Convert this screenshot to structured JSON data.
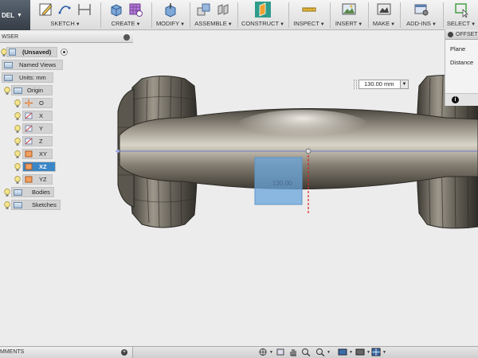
{
  "toolbar": {
    "workspace_label": "DEL",
    "groups": [
      {
        "label": "SKETCH"
      },
      {
        "label": "CREATE"
      },
      {
        "label": "MODIFY"
      },
      {
        "label": "ASSEMBLE"
      },
      {
        "label": "CONSTRUCT"
      },
      {
        "label": "INSPECT"
      },
      {
        "label": "INSERT"
      },
      {
        "label": "MAKE"
      },
      {
        "label": "ADD-INS"
      },
      {
        "label": "SELECT"
      }
    ]
  },
  "browser": {
    "title": "WSER",
    "items": [
      {
        "label": "(Unsaved)"
      },
      {
        "label": "Named Views"
      },
      {
        "label": "Units: mm"
      },
      {
        "label": "Origin"
      },
      {
        "label": "O"
      },
      {
        "label": "X"
      },
      {
        "label": "Y"
      },
      {
        "label": "Z"
      },
      {
        "label": "XY"
      },
      {
        "label": "XZ"
      },
      {
        "label": "YZ"
      },
      {
        "label": "Bodies"
      },
      {
        "label": "Sketches"
      }
    ]
  },
  "offset_panel": {
    "title": "OFFSET",
    "rows": [
      {
        "label": "Plane"
      },
      {
        "label": "Distance"
      }
    ],
    "info_icon": "i"
  },
  "dimension": {
    "value": "130.00 mm",
    "plane_label": "130.00"
  },
  "comments": {
    "label": "MMENTS"
  },
  "colors": {
    "selection": "#3b86c6",
    "plane_preview": "#6aa6dc",
    "model_body": "#8c8677",
    "axis_blue": "#5566cc",
    "manipulator_red": "#e02020"
  }
}
